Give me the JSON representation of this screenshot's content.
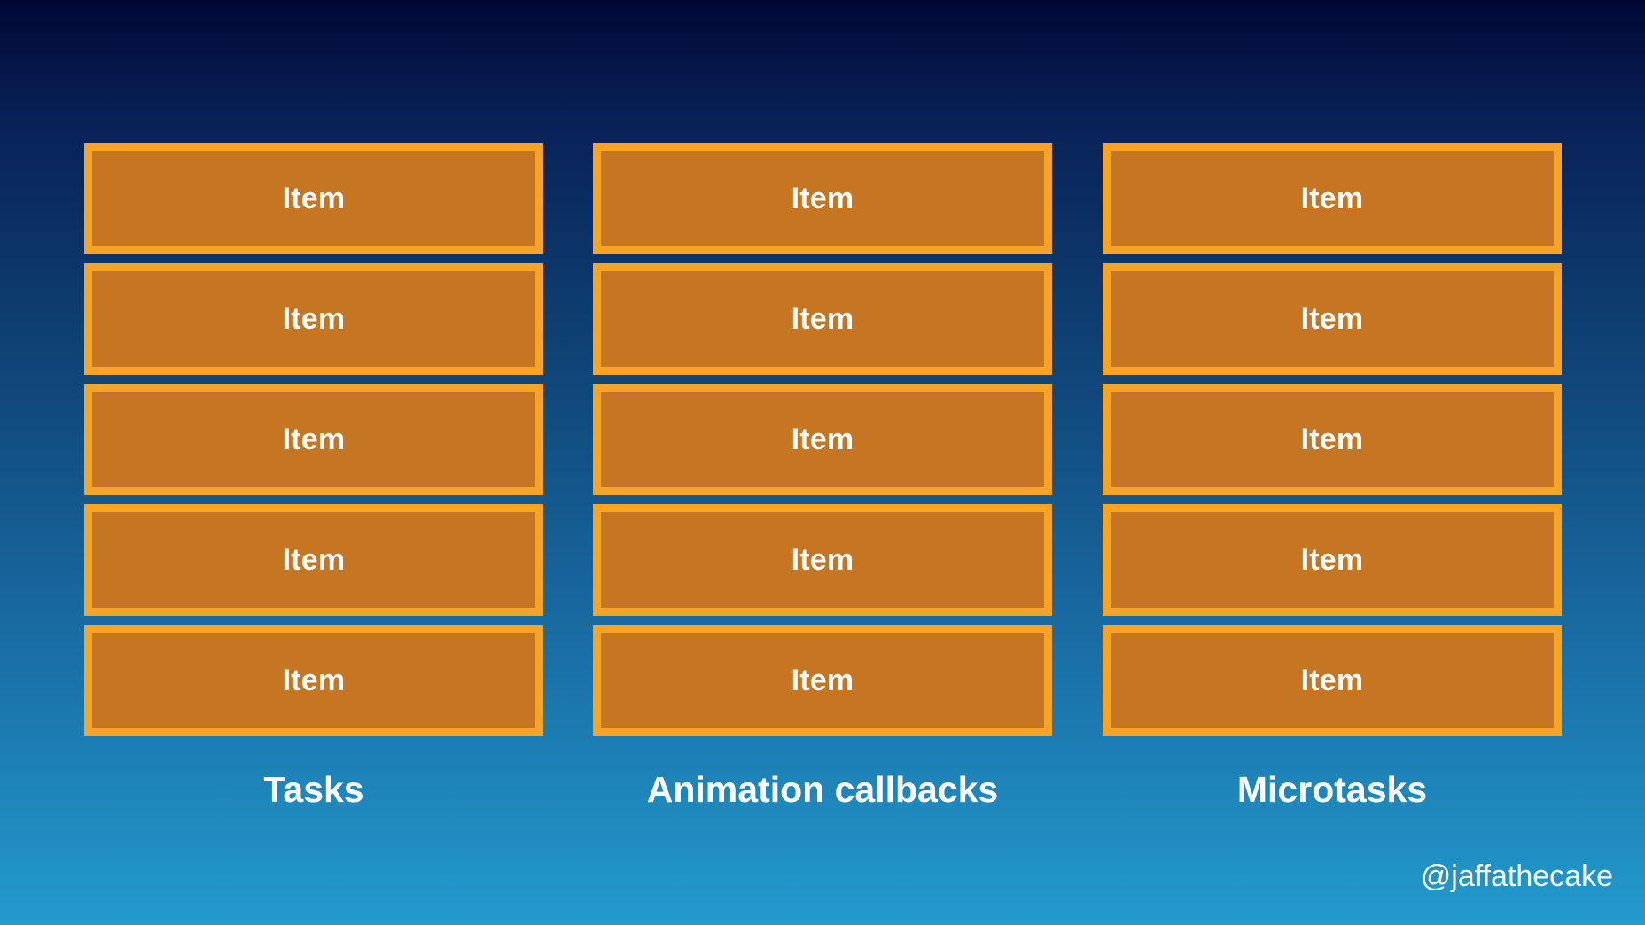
{
  "columns": [
    {
      "label": "Tasks",
      "items": [
        "Item",
        "Item",
        "Item",
        "Item",
        "Item"
      ]
    },
    {
      "label": "Animation callbacks",
      "items": [
        "Item",
        "Item",
        "Item",
        "Item",
        "Item"
      ]
    },
    {
      "label": "Microtasks",
      "items": [
        "Item",
        "Item",
        "Item",
        "Item",
        "Item"
      ]
    }
  ],
  "handle": "@jaffathecake",
  "colors": {
    "item_fill": "#c67522",
    "item_border": "#f5a427",
    "background_top": "#000735",
    "background_bottom": "#229bce",
    "text": "#ffffff"
  }
}
